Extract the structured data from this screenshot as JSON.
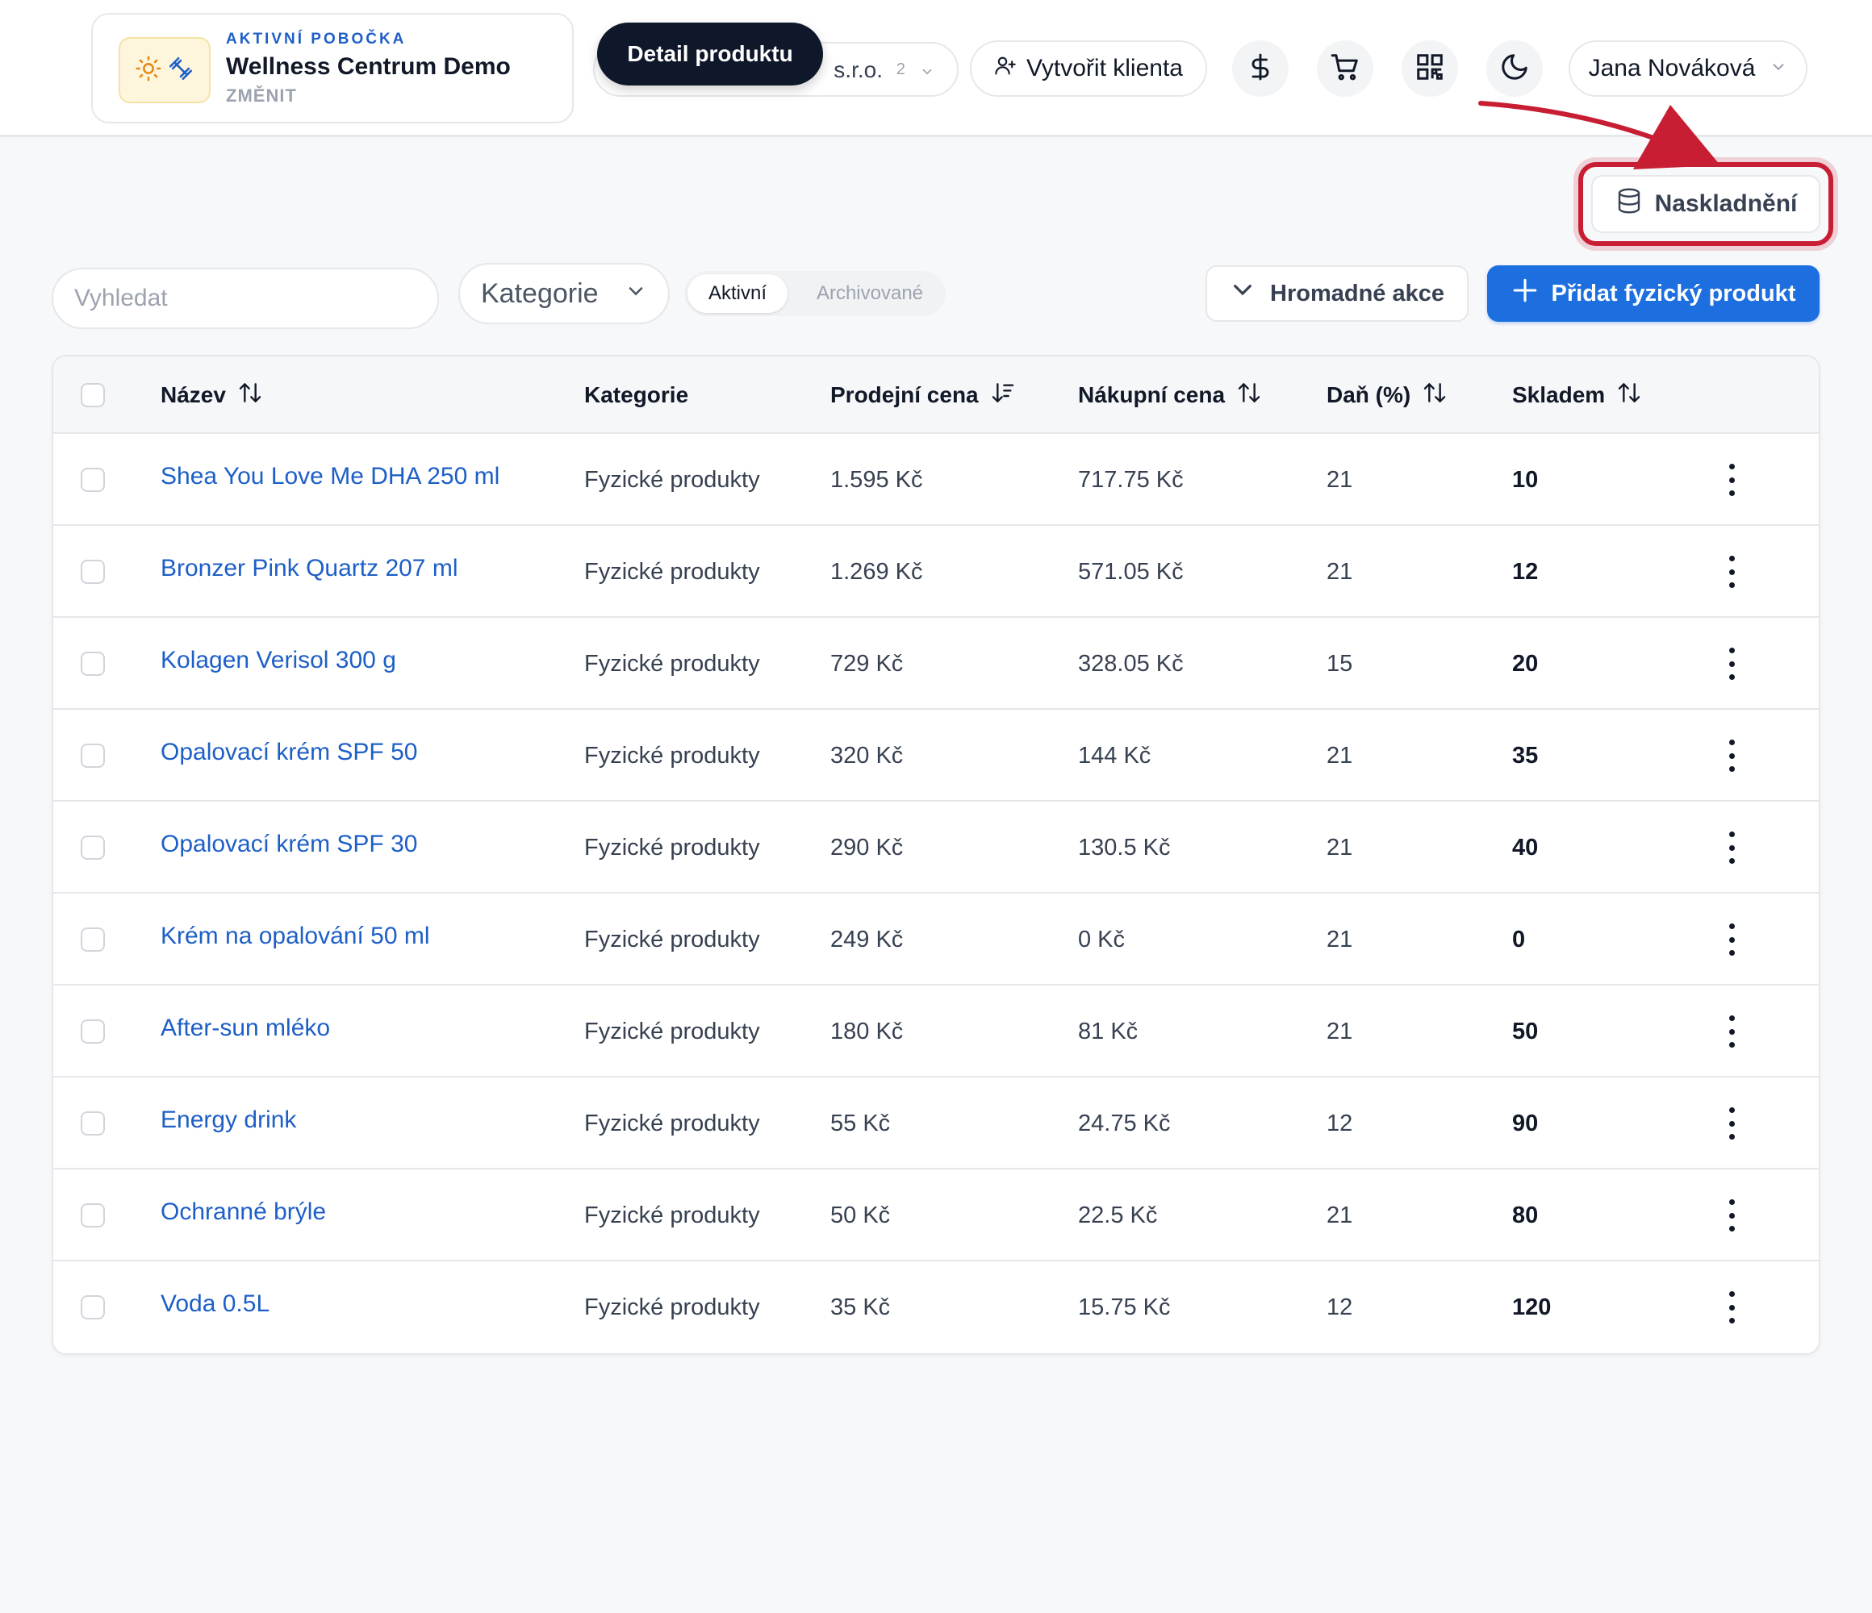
{
  "tooltip": "Detail produktu",
  "branch": {
    "eyebrow": "AKTIVNÍ POBOČKA",
    "name": "Wellness Centrum Demo",
    "change": "ZMĚNIT"
  },
  "company": {
    "name_suffix": "s.r.o.",
    "count": "2"
  },
  "header": {
    "create_client": "Vytvořit klienta",
    "user_name": "Jana Nováková"
  },
  "stock_button": "Naskladnění",
  "toolbar": {
    "search_placeholder": "Vyhledat",
    "category": "Kategorie",
    "tab_active": "Aktivní",
    "tab_archived": "Archivované",
    "bulk_actions": "Hromadné akce",
    "add_product": "Přidat fyzický produkt"
  },
  "columns": {
    "name": "Název",
    "category": "Kategorie",
    "sale_price": "Prodejní cena",
    "purchase_price": "Nákupní cena",
    "tax": "Daň (%)",
    "stock": "Skladem"
  },
  "rows": [
    {
      "name": "Shea You Love Me DHA 250 ml",
      "category": "Fyzické produkty",
      "sale": "1.595 Kč",
      "purchase": "717.75 Kč",
      "tax": "21",
      "stock": "10"
    },
    {
      "name": "Bronzer Pink Quartz 207 ml",
      "category": "Fyzické produkty",
      "sale": "1.269 Kč",
      "purchase": "571.05 Kč",
      "tax": "21",
      "stock": "12"
    },
    {
      "name": "Kolagen Verisol 300 g",
      "category": "Fyzické produkty",
      "sale": "729 Kč",
      "purchase": "328.05 Kč",
      "tax": "15",
      "stock": "20"
    },
    {
      "name": "Opalovací krém SPF 50",
      "category": "Fyzické produkty",
      "sale": "320 Kč",
      "purchase": "144 Kč",
      "tax": "21",
      "stock": "35"
    },
    {
      "name": "Opalovací krém SPF 30",
      "category": "Fyzické produkty",
      "sale": "290 Kč",
      "purchase": "130.5 Kč",
      "tax": "21",
      "stock": "40"
    },
    {
      "name": "Krém na opalování 50 ml",
      "category": "Fyzické produkty",
      "sale": "249 Kč",
      "purchase": "0 Kč",
      "tax": "21",
      "stock": "0"
    },
    {
      "name": "After-sun mléko",
      "category": "Fyzické produkty",
      "sale": "180 Kč",
      "purchase": "81 Kč",
      "tax": "21",
      "stock": "50"
    },
    {
      "name": "Energy drink",
      "category": "Fyzické produkty",
      "sale": "55 Kč",
      "purchase": "24.75 Kč",
      "tax": "12",
      "stock": "90"
    },
    {
      "name": "Ochranné brýle",
      "category": "Fyzické produkty",
      "sale": "50 Kč",
      "purchase": "22.5 Kč",
      "tax": "21",
      "stock": "80"
    },
    {
      "name": "Voda 0.5L",
      "category": "Fyzické produkty",
      "sale": "35 Kč",
      "purchase": "15.75 Kč",
      "tax": "12",
      "stock": "120"
    }
  ],
  "colors": {
    "accent": "#1d6fe0",
    "link": "#1d5fc7",
    "highlight": "#c81e34",
    "tooltip_bg": "#0f172a"
  },
  "icons": {
    "branch_logo": [
      "sun-icon",
      "dumbbell-icon"
    ],
    "header": [
      "user-plus-icon",
      "dollar-icon",
      "cart-icon",
      "qr-code-icon",
      "moon-icon",
      "chevron-down-icon"
    ],
    "stock": "database-icon",
    "sort": [
      "sort-icon",
      "sort-desc-icon"
    ],
    "row_menu": "kebab-menu-icon"
  }
}
